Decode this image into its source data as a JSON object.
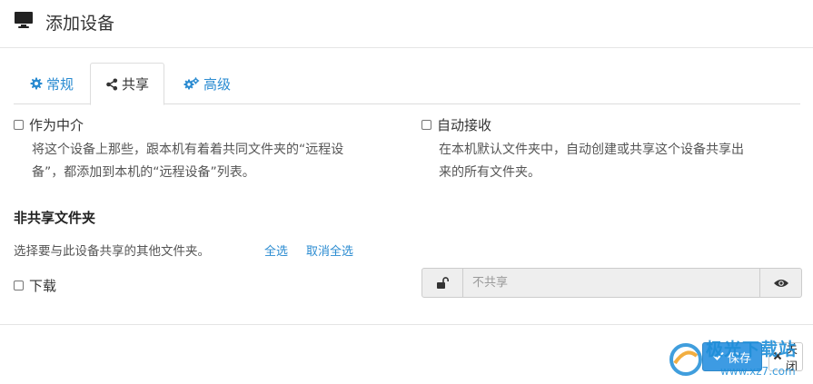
{
  "header": {
    "title": "添加设备",
    "icon": "monitor-icon"
  },
  "tabs": [
    {
      "label": "常规",
      "icon": "gear-icon",
      "active": false
    },
    {
      "label": "共享",
      "icon": "share-icon",
      "active": true
    },
    {
      "label": "高级",
      "icon": "gears-icon",
      "active": false
    }
  ],
  "options": {
    "introducer": {
      "label": "作为中介",
      "checked": false,
      "help_line1": "将这个设备上那些，跟本机有着着共同文件夹的“远程设",
      "help_line2": "备”，都添加到本机的“远程设备”列表。"
    },
    "auto_accept": {
      "label": "自动接收",
      "checked": false,
      "help_line1": "在本机默认文件夹中，自动创建或共享这个设备共享出",
      "help_line2": "来的所有文件夹。"
    }
  },
  "unshared": {
    "title": "非共享文件夹",
    "description": "选择要与此设备共享的其他文件夹。",
    "select_all": "全选",
    "deselect_all": "取消全选",
    "folders": [
      {
        "label": "下载",
        "checked": false,
        "share_placeholder": "不共享"
      }
    ]
  },
  "footer": {
    "save_label": "保存",
    "close_label": "关闭"
  },
  "watermark": {
    "text": "极光下载站",
    "url": "www.xz7.com"
  },
  "colors": {
    "accent": "#2a8bd1",
    "primary_button": "#3d9be3",
    "input_disabled_bg": "#eeeeee"
  }
}
